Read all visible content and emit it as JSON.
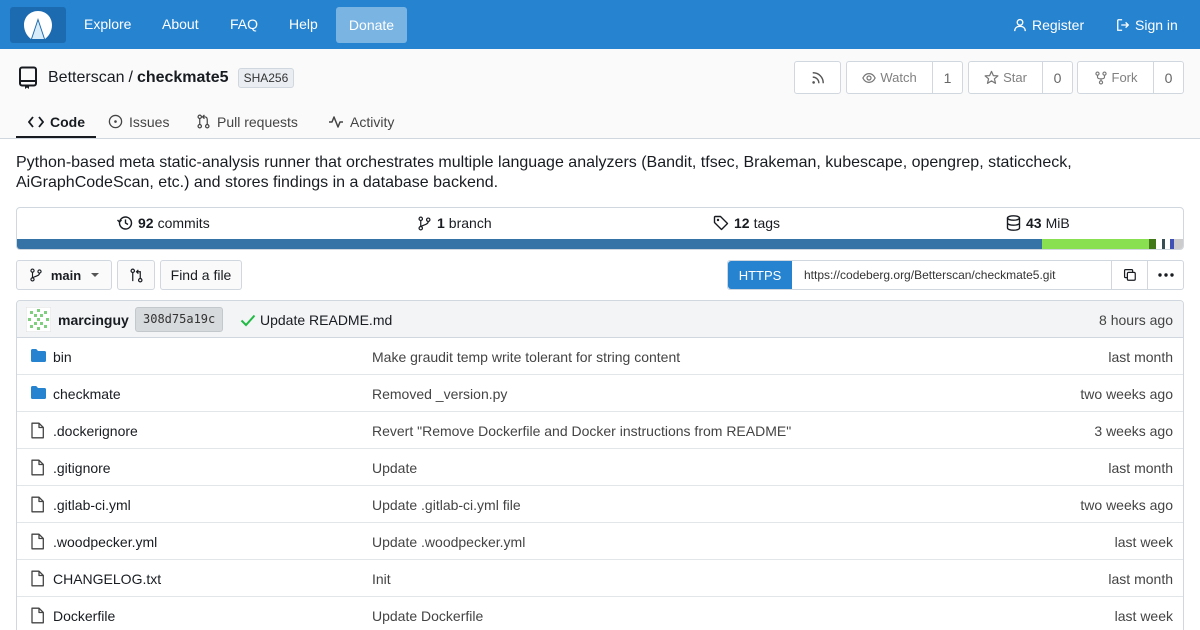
{
  "nav": {
    "links": [
      "Explore",
      "About",
      "FAQ",
      "Help"
    ],
    "donate": "Donate",
    "register": "Register",
    "sign_in": "Sign in"
  },
  "repo": {
    "owner": "Betterscan",
    "separator": "/",
    "name": "checkmate5",
    "badge": "SHA256",
    "watch_label": "Watch",
    "watch_count": "1",
    "star_label": "Star",
    "star_count": "0",
    "fork_label": "Fork",
    "fork_count": "0"
  },
  "tabs": [
    "Code",
    "Issues",
    "Pull requests",
    "Activity"
  ],
  "description": "Python-based meta static-analysis runner that orchestrates multiple language analyzers (Bandit, tfsec, Brakeman, kubescape, opengrep, staticcheck, AiGraphCodeScan, etc.) and stores findings in a database backend.",
  "stats": {
    "commits_count": "92",
    "commits_label": "commits",
    "branch_count": "1",
    "branch_label": "branch",
    "tags_count": "12",
    "tags_label": "tags",
    "size_count": "43",
    "size_label": "MiB"
  },
  "languages": [
    {
      "share": 87.9,
      "color": "#3572a5"
    },
    {
      "share": 9.2,
      "color": "#89e051"
    },
    {
      "share": 0.6,
      "color": "#427819"
    },
    {
      "share": 0.5,
      "color": "#ffffff"
    },
    {
      "share": 0.3,
      "color": "#384d54"
    },
    {
      "share": 0.4,
      "color": "#ffffff"
    },
    {
      "share": 0.3,
      "color": "#3f51b5"
    },
    {
      "share": 0.8,
      "color": "#cccccc"
    }
  ],
  "toolbar": {
    "branch": "main",
    "find_file": "Find a file",
    "clone_protocol": "HTTPS",
    "clone_url": "https://codeberg.org/Betterscan/checkmate5.git"
  },
  "latest_commit": {
    "author": "marcinguy",
    "sha": "308d75a19c",
    "message": "Update README.md",
    "time": "8 hours ago",
    "check_color": "#21ba45"
  },
  "files": [
    {
      "type": "dir",
      "name": "bin",
      "message": "Make graudit temp write tolerant for string content",
      "time": "last month"
    },
    {
      "type": "dir",
      "name": "checkmate",
      "message": "Removed _version.py",
      "time": "two weeks ago"
    },
    {
      "type": "file",
      "name": ".dockerignore",
      "message": "Revert \"Remove Dockerfile and Docker instructions from README\"",
      "time": "3 weeks ago"
    },
    {
      "type": "file",
      "name": ".gitignore",
      "message": "Update",
      "time": "last month"
    },
    {
      "type": "file",
      "name": ".gitlab-ci.yml",
      "message": "Update .gitlab-ci.yml file",
      "time": "two weeks ago"
    },
    {
      "type": "file",
      "name": ".woodpecker.yml",
      "message": "Update .woodpecker.yml",
      "time": "last week"
    },
    {
      "type": "file",
      "name": "CHANGELOG.txt",
      "message": "Init",
      "time": "last month"
    },
    {
      "type": "file",
      "name": "Dockerfile",
      "message": "Update Dockerfile",
      "time": "last week"
    }
  ],
  "colors": {
    "accent": "#2683d0",
    "folder": "#2683d0"
  }
}
